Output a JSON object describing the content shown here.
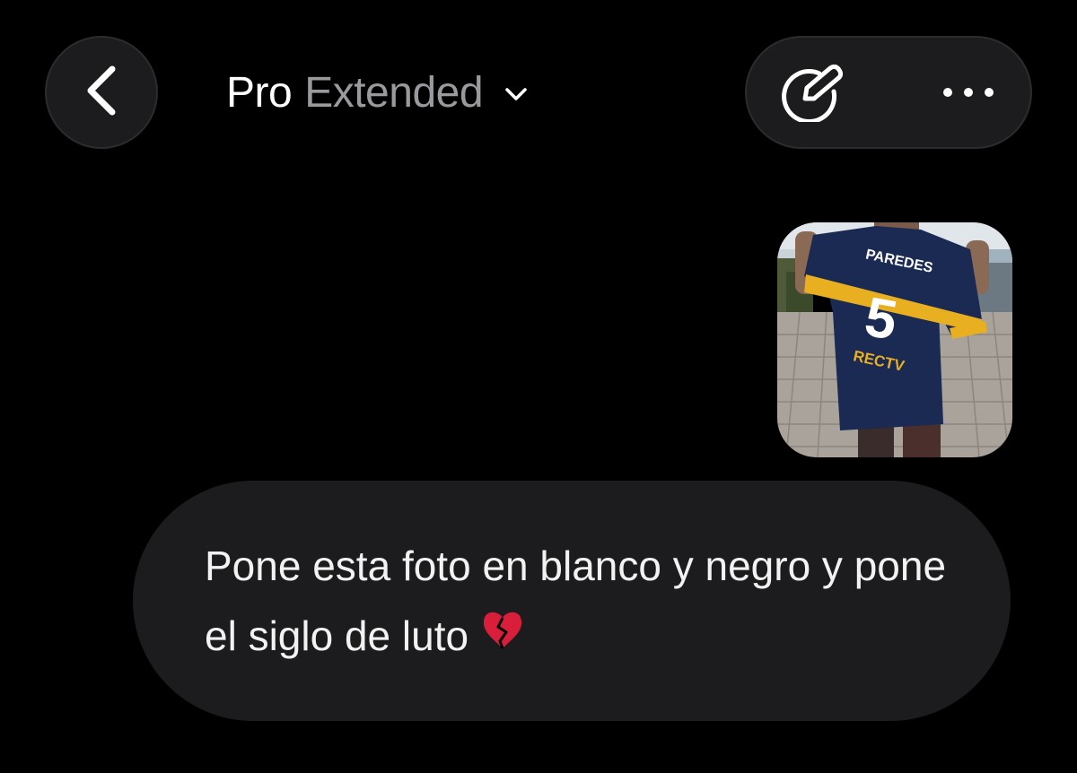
{
  "header": {
    "back_icon": "chevron-left-icon",
    "title_primary": "Pro",
    "title_secondary": "Extended",
    "dropdown_icon": "chevron-down-icon",
    "edit_icon": "pencil-new-chat-icon",
    "more_icon": "ellipsis-icon"
  },
  "chat": {
    "image_attachment": {
      "jersey_name": "PAREDES",
      "jersey_number": "5",
      "sponsor_text": "RECTV"
    },
    "message_text": "Pone esta foto en blanco y negro y pone el siglo de luto",
    "message_emoji": "broken-heart-icon"
  },
  "colors": {
    "background": "#000000",
    "surface": "#1c1c1e",
    "text_primary": "#ffffff",
    "text_secondary": "#9a9a9e",
    "jersey_blue": "#1a2a52",
    "jersey_gold": "#e8b021",
    "broken_heart": "#d91e3b"
  }
}
